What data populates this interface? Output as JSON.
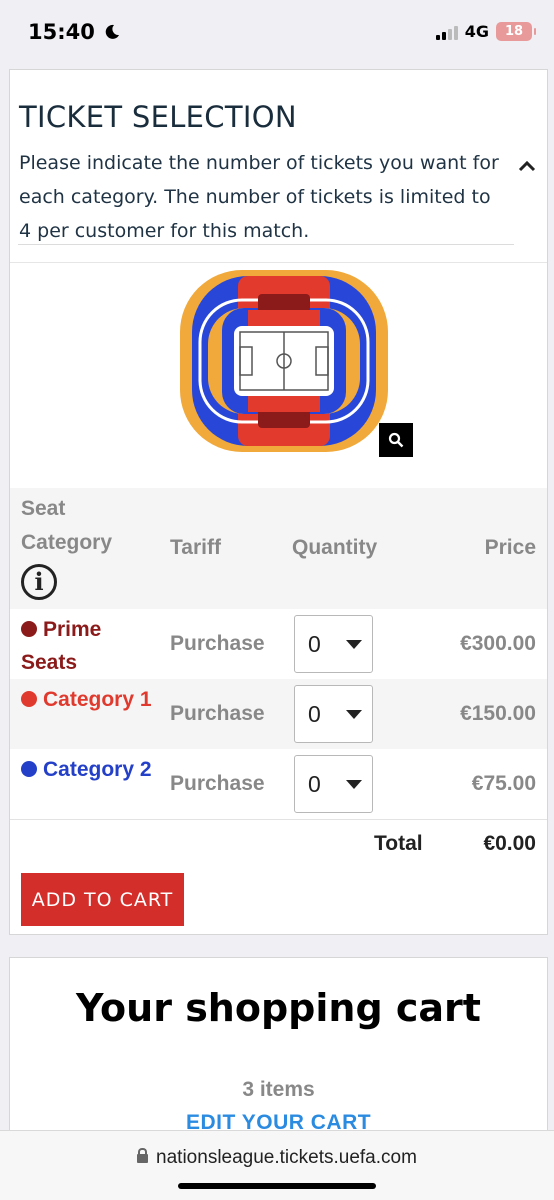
{
  "status": {
    "time": "15:40",
    "network": "4G",
    "battery": "18",
    "moon_icon": "moon-icon"
  },
  "ticket_selection": {
    "title": "TICKET SELECTION",
    "description": "Please indicate the number of tickets you want for each category. The number of tickets is limited to 4 per customer for this match."
  },
  "table": {
    "headers": {
      "seat_category": "Seat Category",
      "tariff": "Tariff",
      "quantity": "Quantity",
      "price": "Price",
      "info_icon": "i"
    },
    "rows": [
      {
        "category": "Prime Seats",
        "color": "#8b1a1a",
        "tariff": "Purchase",
        "quantity": "0",
        "price": "€300.00"
      },
      {
        "category": "Category 1",
        "color": "#e03a2e",
        "tariff": "Purchase",
        "quantity": "0",
        "price": "€150.00"
      },
      {
        "category": "Category 2",
        "color": "#2440c8",
        "tariff": "Purchase",
        "quantity": "0",
        "price": "€75.00"
      }
    ],
    "total_label": "Total",
    "total_value": "€0.00"
  },
  "add_to_cart": "ADD TO CART",
  "cart": {
    "title": "Your shopping cart",
    "items": "3 items",
    "edit": "EDIT YOUR CART"
  },
  "browser": {
    "url": "nationsleague.tickets.uefa.com"
  },
  "colors": {
    "accent_red": "#d42e2b",
    "link_blue": "#2b8be0",
    "title_navy": "#1a2d3d"
  }
}
